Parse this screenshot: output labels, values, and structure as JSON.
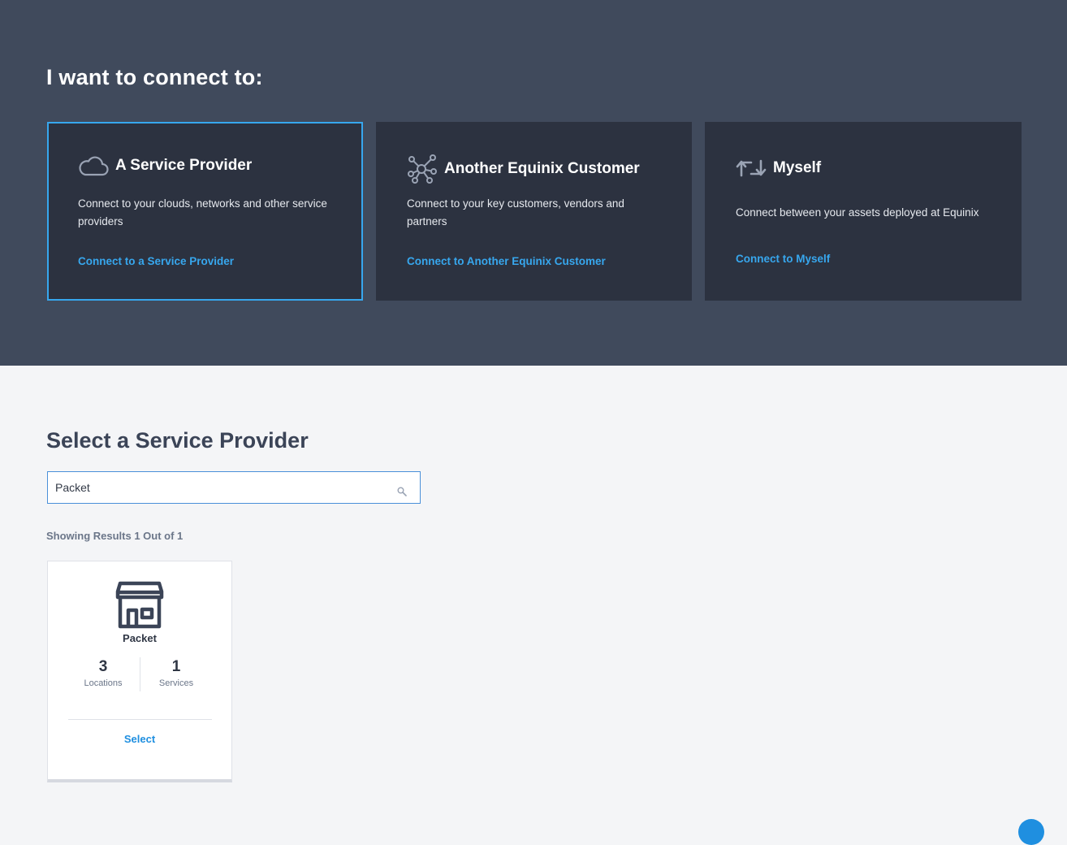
{
  "hero": {
    "title": "I want to connect to:"
  },
  "options": [
    {
      "title": "A Service Provider",
      "description": "Connect to your clouds, networks and other service providers",
      "link": "Connect to a Service Provider",
      "icon": "cloud-icon",
      "selected": true
    },
    {
      "title": "Another Equinix Customer",
      "description": "Connect to your key customers, vendors and partners",
      "link": "Connect to Another Equinix Customer",
      "icon": "network-nodes-icon",
      "selected": false
    },
    {
      "title": "Myself",
      "description": "Connect between your assets deployed at Equinix",
      "link": "Connect to Myself",
      "icon": "swap-arrows-icon",
      "selected": false
    }
  ],
  "provider_section": {
    "title": "Select a Service Provider",
    "search_value": "Packet",
    "results_text": "Showing Results 1 Out of 1"
  },
  "providers": [
    {
      "name": "Packet",
      "icon": "storefront-icon",
      "locations_value": "3",
      "locations_label": "Locations",
      "services_value": "1",
      "services_label": "Services",
      "select_label": "Select"
    }
  ],
  "colors": {
    "hero_bg": "#404a5c",
    "card_bg": "#2c3240",
    "accent": "#37a7ee",
    "page_bg": "#f4f5f7"
  }
}
